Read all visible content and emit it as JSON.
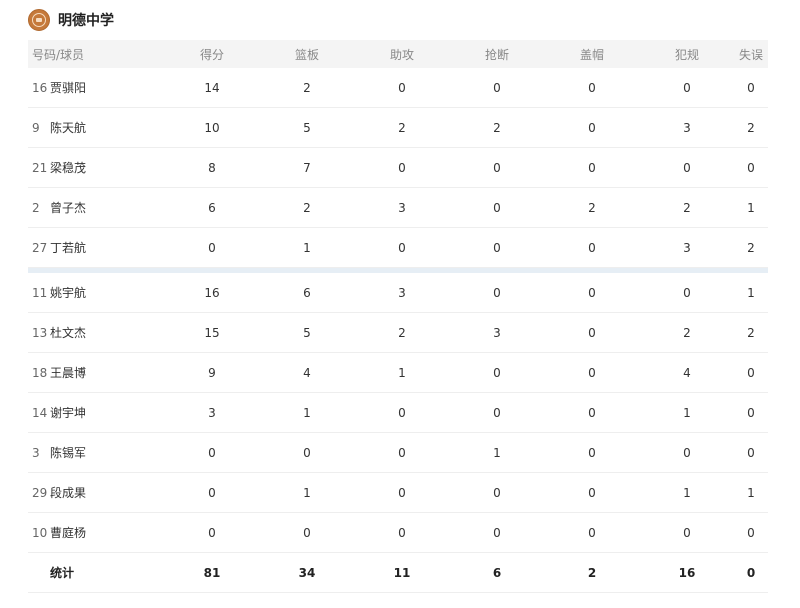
{
  "school": {
    "name": "明德中学",
    "logo_icon": "school-emblem-icon",
    "brand_color": "#c5793a"
  },
  "table": {
    "headers": {
      "player": "号码/球员",
      "pts": "得分",
      "reb": "篮板",
      "ast": "助攻",
      "stl": "抢断",
      "blk": "盖帽",
      "pf": "犯规",
      "to": "失误"
    },
    "starters": [
      {
        "num": "16",
        "name": "贾骐阳",
        "pts": "14",
        "reb": "2",
        "ast": "0",
        "stl": "0",
        "blk": "0",
        "pf": "0",
        "to": "0"
      },
      {
        "num": "9",
        "name": "陈天航",
        "pts": "10",
        "reb": "5",
        "ast": "2",
        "stl": "2",
        "blk": "0",
        "pf": "3",
        "to": "2"
      },
      {
        "num": "21",
        "name": "梁稳茂",
        "pts": "8",
        "reb": "7",
        "ast": "0",
        "stl": "0",
        "blk": "0",
        "pf": "0",
        "to": "0"
      },
      {
        "num": "2",
        "name": "曾子杰",
        "pts": "6",
        "reb": "2",
        "ast": "3",
        "stl": "0",
        "blk": "2",
        "pf": "2",
        "to": "1"
      },
      {
        "num": "27",
        "name": "丁若航",
        "pts": "0",
        "reb": "1",
        "ast": "0",
        "stl": "0",
        "blk": "0",
        "pf": "3",
        "to": "2"
      }
    ],
    "bench": [
      {
        "num": "11",
        "name": "姚宇航",
        "pts": "16",
        "reb": "6",
        "ast": "3",
        "stl": "0",
        "blk": "0",
        "pf": "0",
        "to": "1"
      },
      {
        "num": "13",
        "name": "杜文杰",
        "pts": "15",
        "reb": "5",
        "ast": "2",
        "stl": "3",
        "blk": "0",
        "pf": "2",
        "to": "2"
      },
      {
        "num": "18",
        "name": "王晨博",
        "pts": "9",
        "reb": "4",
        "ast": "1",
        "stl": "0",
        "blk": "0",
        "pf": "4",
        "to": "0"
      },
      {
        "num": "14",
        "name": "谢宇坤",
        "pts": "3",
        "reb": "1",
        "ast": "0",
        "stl": "0",
        "blk": "0",
        "pf": "1",
        "to": "0"
      },
      {
        "num": "3",
        "name": "陈锡军",
        "pts": "0",
        "reb": "0",
        "ast": "0",
        "stl": "1",
        "blk": "0",
        "pf": "0",
        "to": "0"
      },
      {
        "num": "29",
        "name": "段成果",
        "pts": "0",
        "reb": "1",
        "ast": "0",
        "stl": "0",
        "blk": "0",
        "pf": "1",
        "to": "1"
      },
      {
        "num": "10",
        "name": "曹庭杨",
        "pts": "0",
        "reb": "0",
        "ast": "0",
        "stl": "0",
        "blk": "0",
        "pf": "0",
        "to": "0"
      }
    ],
    "totals": {
      "label": "统计",
      "pts": "81",
      "reb": "34",
      "ast": "11",
      "stl": "6",
      "blk": "2",
      "pf": "16",
      "to": "0"
    }
  }
}
